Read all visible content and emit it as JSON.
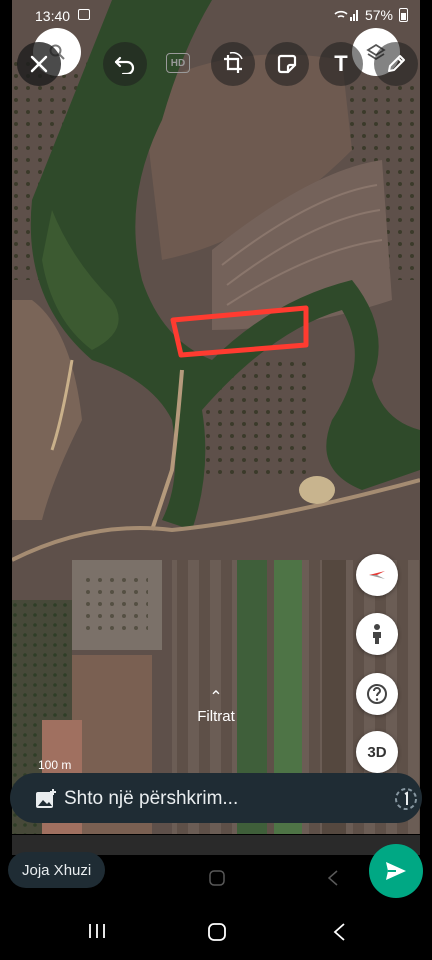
{
  "status_bar": {
    "time": "13:40",
    "battery": "57%"
  },
  "toolbar": {
    "hd_label": "HD",
    "text_tool_label": "T"
  },
  "map": {
    "filter_label": "Filtrat",
    "scale_label": "100 m",
    "button_3d_label": "3D",
    "annotation_color": "#ff3b30"
  },
  "caption_bar": {
    "placeholder": "Shto një përshkrim..."
  },
  "recipient": {
    "name": "Joja Xhuzi"
  },
  "colors": {
    "send_button": "#00a884",
    "caption_bg": "#1f2c34"
  },
  "icons": [
    "close-icon",
    "undo-icon",
    "crop-rotate-icon",
    "sticker-icon",
    "text-icon",
    "draw-icon",
    "layers-icon",
    "compass-icon",
    "pegman-icon",
    "help-icon",
    "gallery-add-icon",
    "view-once-icon",
    "send-icon",
    "recents-icon",
    "home-icon",
    "back-icon"
  ]
}
